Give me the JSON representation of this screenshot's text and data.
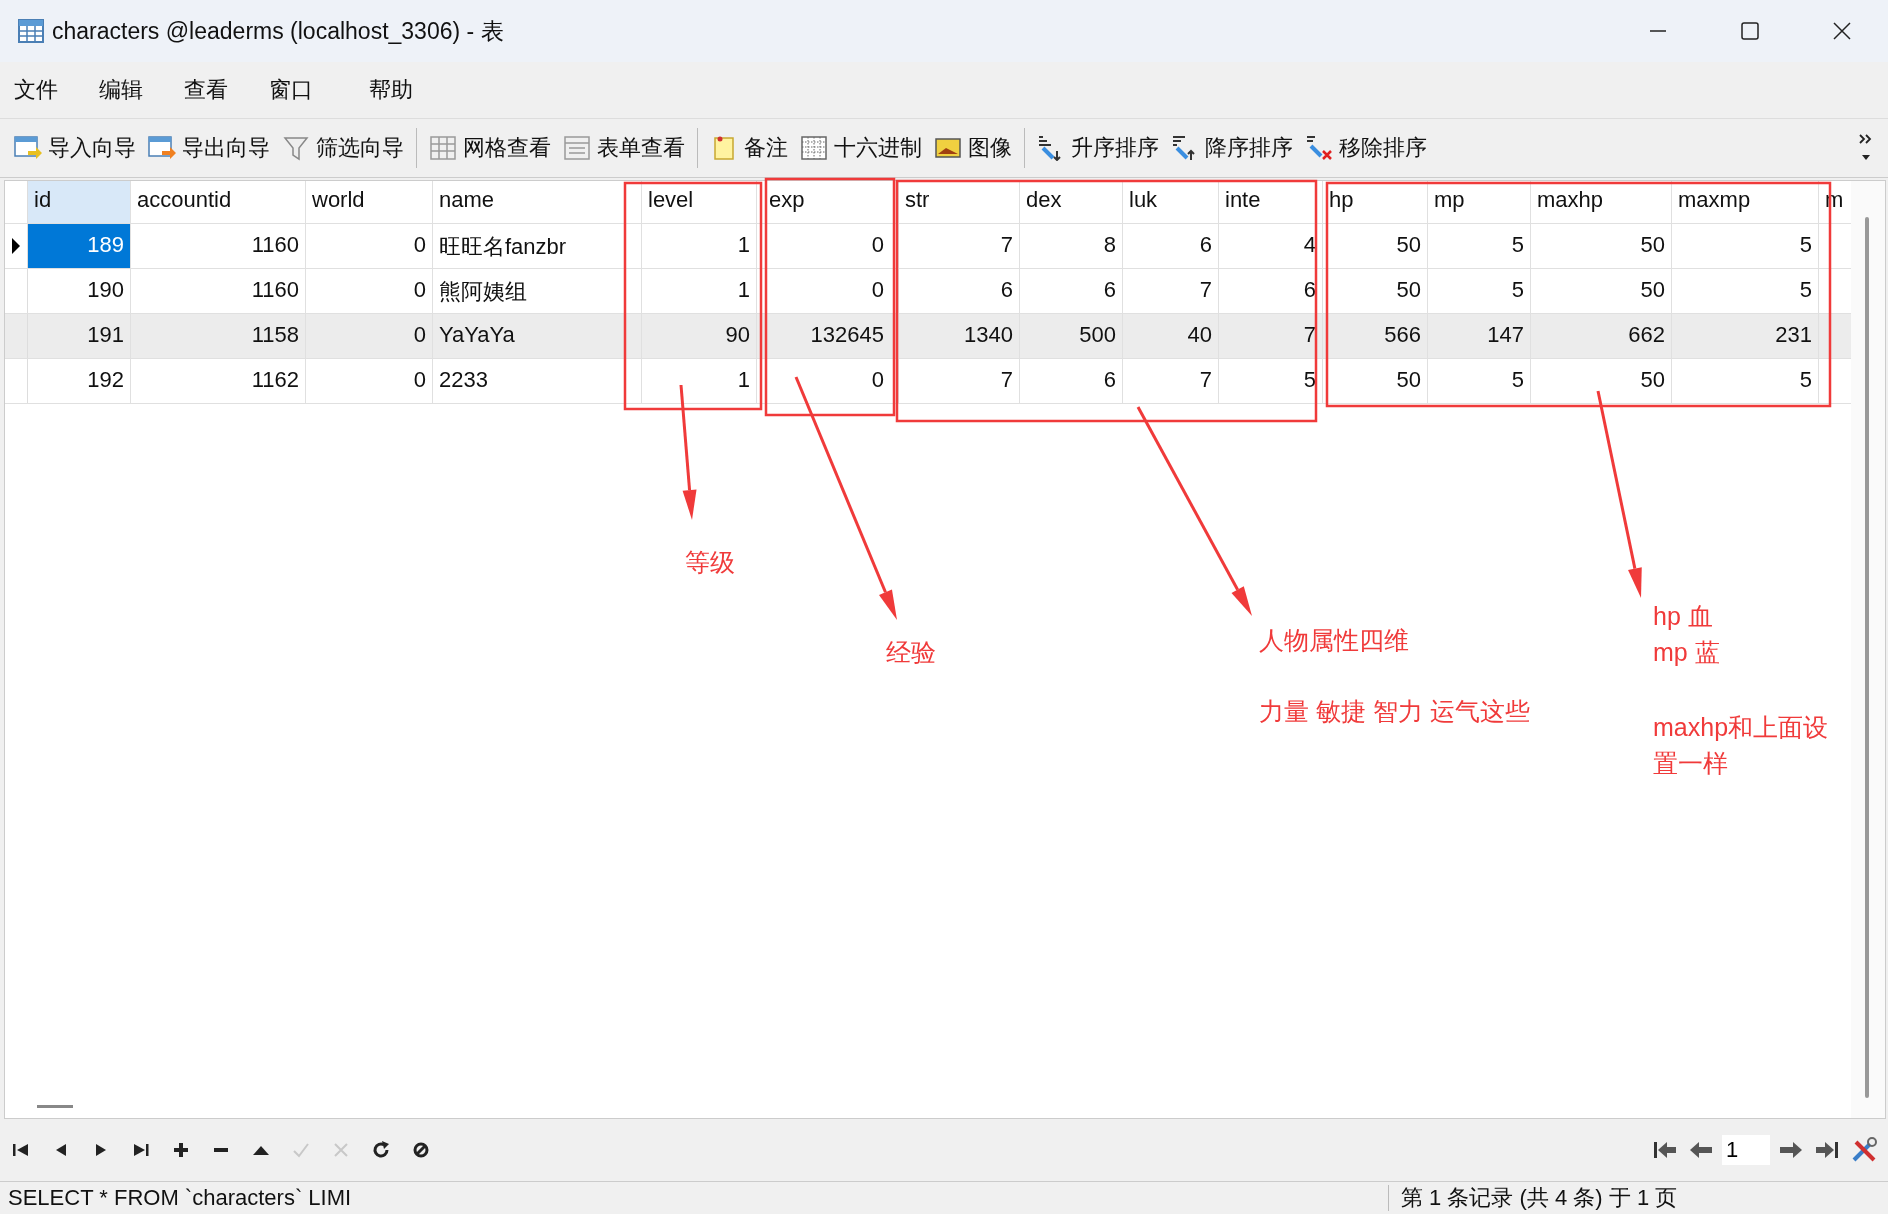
{
  "window": {
    "title": "characters @leaderms (localhost_3306) - 表"
  },
  "menu": [
    "文件",
    "编辑",
    "查看",
    "窗口",
    "帮助"
  ],
  "toolbar_groups": [
    [
      "导入向导",
      "导出向导",
      "筛选向导"
    ],
    [
      "网格查看",
      "表单查看"
    ],
    [
      "备注",
      "十六进制",
      "图像"
    ],
    [
      "升序排序",
      "降序排序",
      "移除排序"
    ]
  ],
  "table": {
    "columns": [
      {
        "label": "id",
        "kind": "number",
        "selected": true
      },
      {
        "label": "accountid",
        "kind": "number",
        "selected": false
      },
      {
        "label": "world",
        "kind": "number",
        "selected": false
      },
      {
        "label": "name",
        "kind": "text",
        "selected": false
      },
      {
        "label": "level",
        "kind": "number",
        "selected": false
      },
      {
        "label": "exp",
        "kind": "number",
        "selected": false
      },
      {
        "label": "str",
        "kind": "number",
        "selected": false
      },
      {
        "label": "dex",
        "kind": "number",
        "selected": false
      },
      {
        "label": "luk",
        "kind": "number",
        "selected": false
      },
      {
        "label": "inte",
        "kind": "number",
        "selected": false
      },
      {
        "label": "hp",
        "kind": "number",
        "selected": false
      },
      {
        "label": "mp",
        "kind": "number",
        "selected": false
      },
      {
        "label": "maxhp",
        "kind": "number",
        "selected": false
      },
      {
        "label": "maxmp",
        "kind": "number",
        "selected": false
      },
      {
        "label": "m",
        "selected": false
      }
    ],
    "rows": [
      {
        "selected": true,
        "highlighted": false,
        "cells": [
          "189",
          "1160",
          "0",
          "旺旺名fanzbr",
          "1",
          "0",
          "7",
          "8",
          "6",
          "4",
          "50",
          "5",
          "50",
          "5"
        ]
      },
      {
        "selected": false,
        "highlighted": false,
        "cells": [
          "190",
          "1160",
          "0",
          "熊阿姨组",
          "1",
          "0",
          "6",
          "6",
          "7",
          "6",
          "50",
          "5",
          "50",
          "5"
        ]
      },
      {
        "selected": false,
        "highlighted": true,
        "cells": [
          "191",
          "1158",
          "0",
          "YaYaYa",
          "90",
          "132645",
          "1340",
          "500",
          "40",
          "7",
          "566",
          "147",
          "662",
          "231"
        ]
      },
      {
        "selected": false,
        "highlighted": false,
        "cells": [
          "192",
          "1162",
          "0",
          "2233",
          "1",
          "0",
          "7",
          "6",
          "7",
          "5",
          "50",
          "5",
          "50",
          "5"
        ]
      }
    ]
  },
  "nav_buttons": [
    {
      "disabled": false
    },
    {
      "disabled": false
    },
    {
      "disabled": false
    },
    {
      "disabled": false
    },
    {
      "disabled": false
    },
    {
      "disabled": false
    },
    {
      "disabled": false
    },
    {
      "disabled": true
    },
    {
      "disabled": true
    },
    {
      "disabled": false
    },
    {
      "disabled": false
    }
  ],
  "page_field": {
    "value": "1"
  },
  "status_bar": {
    "sql": "SELECT * FROM `characters` LIMI",
    "record_info": "第 1 条记录 (共 4 条) 于 1 页"
  },
  "annotations": [
    {
      "lines": [
        "等级"
      ]
    },
    {
      "lines": [
        "经验"
      ]
    },
    {
      "lines": [
        "人物属性四维",
        "力量 敏捷  智力 运气这些"
      ]
    },
    {
      "lines": [
        "hp 血",
        "mp 蓝",
        "maxhp和上面设置一样"
      ]
    }
  ]
}
